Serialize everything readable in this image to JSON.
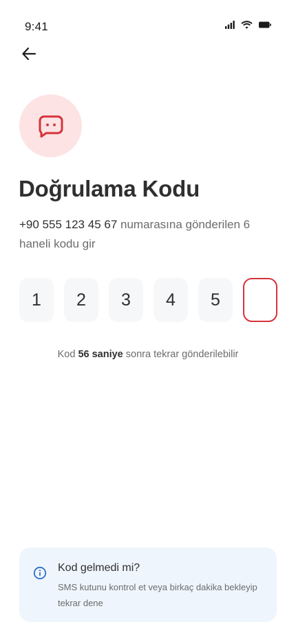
{
  "status_bar": {
    "time": "9:41"
  },
  "icons": {
    "back": "arrow-left-icon",
    "hero": "message-icon",
    "info": "info-icon"
  },
  "colors": {
    "accent": "#d6333b",
    "hero_bg": "#fde3e3",
    "info_bg": "#eef5fd",
    "info_icon": "#2f6fc5"
  },
  "header": {
    "title": "Doğrulama Kodu",
    "phone": "+90 555 123 45 67",
    "description": " numarasına gönderilen 6 haneli kodu gir"
  },
  "otp": {
    "digits": [
      "1",
      "2",
      "3",
      "4",
      "5",
      ""
    ]
  },
  "resend": {
    "prefix": "Kod ",
    "seconds": "56 saniye",
    "suffix": " sonra tekrar gönderilebilir"
  },
  "info": {
    "title": "Kod gelmedi mi?",
    "text": "SMS kutunu kontrol et veya birkaç dakika bekleyip tekrar dene"
  }
}
